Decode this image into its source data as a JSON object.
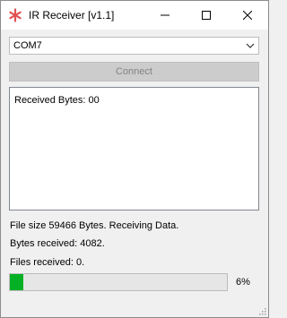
{
  "window": {
    "title": "IR Receiver [v1.1]",
    "icon": "asterisk-icon",
    "accent": "#e05252"
  },
  "titlebar_buttons": {
    "minimize": "minimize-icon",
    "maximize": "maximize-icon",
    "close": "close-icon"
  },
  "port": {
    "selected": "COM7"
  },
  "connect": {
    "label": "Connect",
    "enabled": false
  },
  "log": {
    "text": "Received Bytes: 00"
  },
  "status": {
    "file_size": "File size 59466 Bytes. Receiving Data.",
    "bytes_received": "Bytes received: 4082.",
    "files_received": "Files received: 0."
  },
  "progress": {
    "value": 0.06,
    "label": "6%",
    "color": "#06b025"
  }
}
